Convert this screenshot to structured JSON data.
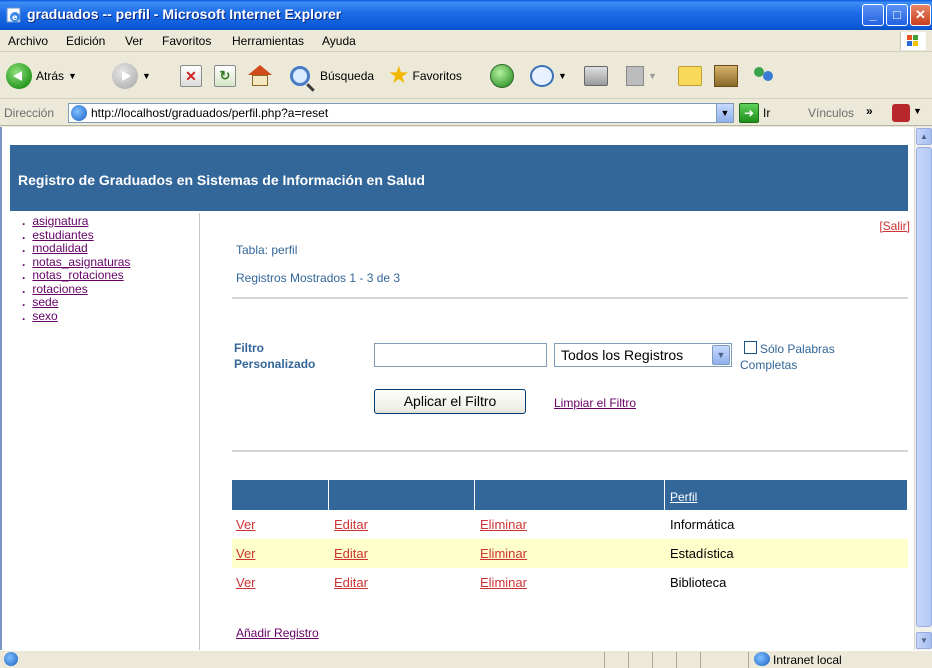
{
  "window": {
    "title": "graduados -- perfil - Microsoft Internet Explorer"
  },
  "menubar": {
    "items": [
      "Archivo",
      "Edición",
      "Ver",
      "Favoritos",
      "Herramientas",
      "Ayuda"
    ]
  },
  "toolbar": {
    "back_label": "Atrás",
    "search_label": "Búsqueda",
    "favorites_label": "Favoritos"
  },
  "addressbar": {
    "label": "Dirección",
    "url": "http://localhost/graduados/perfil.php?a=reset",
    "go_label": "Ir",
    "links_label": "Vínculos"
  },
  "page": {
    "site_title": "Registro de Graduados en Sistemas de Información en Salud",
    "logout_label": "[Salir]",
    "nav": [
      "asignatura",
      "estudiantes",
      "modalidad",
      "notas_asignaturas",
      "notas_rotaciones",
      "rotaciones",
      "sede",
      "sexo"
    ],
    "table_label": "Tabla: perfil",
    "records_label": "Registros Mostrados 1 - 3 de 3",
    "filter": {
      "label_line1": "Filtro",
      "label_line2": "Personalizado",
      "input_value": "",
      "select_value": "Todos los Registros",
      "whole_words_line1": "Sólo Palabras",
      "whole_words_line2": "Completas",
      "whole_words_checked": false,
      "apply_label": "Aplicar el Filtro",
      "clear_label": "Limpiar el Filtro"
    },
    "grid": {
      "column_header": "Perfil",
      "view_label": "Ver",
      "edit_label": "Editar",
      "delete_label": "Eliminar",
      "rows": [
        "Informática",
        "Estadística",
        "Biblioteca"
      ]
    },
    "add_record_label": "Añadir Registro"
  },
  "statusbar": {
    "zone": "Intranet local"
  }
}
